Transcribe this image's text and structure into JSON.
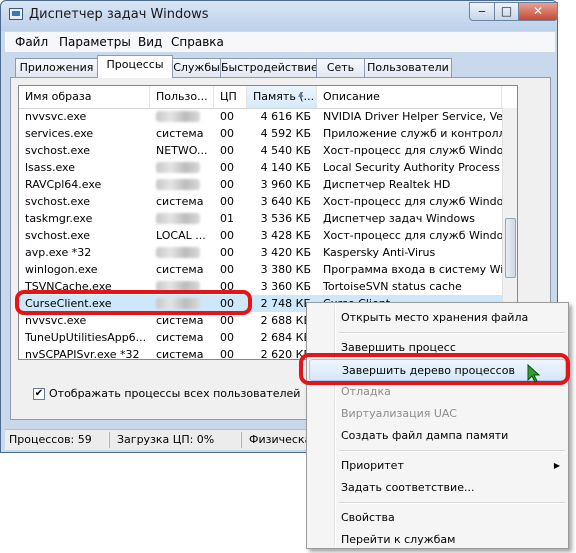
{
  "window": {
    "title": "Диспетчер задач Windows",
    "btn_min": "‒",
    "btn_max": "□",
    "btn_close": "✕"
  },
  "menu": [
    "Файл",
    "Параметры",
    "Вид",
    "Справка"
  ],
  "tabs": [
    "Приложения",
    "Процессы",
    "Службы",
    "Быстродействие",
    "Сеть",
    "Пользователи"
  ],
  "active_tab": "Процессы",
  "columns": [
    "Имя образа",
    "Пользо...",
    "ЦП",
    "Память (...",
    "Описание"
  ],
  "sorted_column": "Память (...",
  "rows": [
    {
      "name": "nvvsvc.exe",
      "user": "",
      "cpu": "00",
      "mem": "4 616 КБ",
      "desc": "NVIDIA Driver Helper Service, Versio"
    },
    {
      "name": "services.exe",
      "user": "система",
      "cpu": "00",
      "mem": "4 592 КБ",
      "desc": "Приложение служб и контроллер"
    },
    {
      "name": "svchost.exe",
      "user": "NETWO...",
      "cpu": "00",
      "mem": "4 540 КБ",
      "desc": "Хост-процесс для служб Windows"
    },
    {
      "name": "lsass.exe",
      "user": "",
      "cpu": "00",
      "mem": "4 140 КБ",
      "desc": "Local Security Authority Process"
    },
    {
      "name": "RAVCpl64.exe",
      "user": "",
      "cpu": "00",
      "mem": "3 960 КБ",
      "desc": "Диспетчер Realtek HD"
    },
    {
      "name": "svchost.exe",
      "user": "система",
      "cpu": "00",
      "mem": "3 640 КБ",
      "desc": "Хост-процесс для служб Windows"
    },
    {
      "name": "taskmgr.exe",
      "user": "",
      "cpu": "01",
      "mem": "3 536 КБ",
      "desc": "Диспетчер задач Windows"
    },
    {
      "name": "svchost.exe",
      "user": "LOCAL ...",
      "cpu": "00",
      "mem": "3 428 КБ",
      "desc": "Хост-процесс для служб Windows"
    },
    {
      "name": "avp.exe *32",
      "user": "",
      "cpu": "00",
      "mem": "3 420 КБ",
      "desc": "Kaspersky Anti-Virus"
    },
    {
      "name": "winlogon.exe",
      "user": "система",
      "cpu": "00",
      "mem": "3 380 КБ",
      "desc": "Программа входа в систему Wind"
    },
    {
      "name": "TSVNCache.exe",
      "user": "",
      "cpu": "00",
      "mem": "3 360 КБ",
      "desc": "TortoiseSVN status cache"
    },
    {
      "name": "CurseClient.exe",
      "user": "",
      "cpu": "00",
      "mem": "2 748 КБ",
      "desc": "Curse Client"
    },
    {
      "name": "nvvsvc.exe",
      "user": "система",
      "cpu": "00",
      "mem": "2 688 КБ",
      "desc": ""
    },
    {
      "name": "TuneUpUtilitiesApp6...",
      "user": "система",
      "cpu": "00",
      "mem": "2 684 КБ",
      "desc": ""
    },
    {
      "name": "nvSCPAPISvr.exe *32",
      "user": "система",
      "cpu": "00",
      "mem": "2 620 КБ",
      "desc": ""
    }
  ],
  "show_all_users_label": "Отображать процессы всех пользователей",
  "show_all_users_checked": "✔",
  "status": {
    "processes": "Процессов: 59",
    "cpu": "Загрузка ЦП: 0%",
    "memory": "Физическа"
  },
  "context_menu": {
    "items": [
      {
        "label": "Открыть место хранения файла",
        "disabled": false
      },
      {
        "sep": true
      },
      {
        "label": "Завершить процесс",
        "disabled": false
      },
      {
        "label": "Завершить дерево процессов",
        "disabled": false,
        "hover": true
      },
      {
        "label": "Отладка",
        "disabled": true
      },
      {
        "label": "Виртуализация UAC",
        "disabled": true
      },
      {
        "label": "Создать файл дампа памяти",
        "disabled": false
      },
      {
        "sep": true
      },
      {
        "label": "Приоритет",
        "disabled": false,
        "submenu": true
      },
      {
        "label": "Задать соответствие...",
        "disabled": false
      },
      {
        "sep": true
      },
      {
        "label": "Свойства",
        "disabled": false
      },
      {
        "label": "Перейти к службам",
        "disabled": false
      }
    ],
    "submenu_arrow": "▶"
  },
  "colors": {
    "highlight_red": "#e3151b",
    "selection": "#cde8fb",
    "cursor_green": "#2f9e2f"
  }
}
